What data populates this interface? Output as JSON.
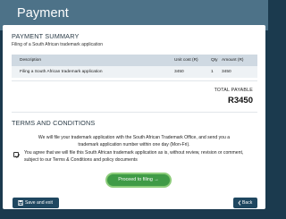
{
  "header": {
    "title": "Payment"
  },
  "summary": {
    "heading": "PAYMENT SUMMARY",
    "subtitle": "Filing of a South African trademark application",
    "table": {
      "headers": [
        "Description",
        "Unit cost (R)",
        "Qty",
        "Amount (R)"
      ],
      "rows": [
        [
          "Filing a South African trademark application",
          "3450",
          "1",
          "3450"
        ]
      ]
    },
    "total_label": "TOTAL PAYABLE",
    "total_value": "R3450"
  },
  "terms": {
    "heading": "TERMS AND CONDITIONS",
    "text": "We will file your trademark application with the South African Trademark Office, and send you a trademark application number within one day (Mon-Fri).",
    "agree_text": "You agree that we will file this South African trademark application as is, without review, revision or comment, subject to our Terms & Conditions and policy documents",
    "agree_checked": true
  },
  "buttons": {
    "proceed": "Proceed to filing →",
    "save_exit": "Save and exit",
    "back": "Back"
  },
  "icons": {
    "checkbox": "check-icon",
    "save": "floppy-disk-icon",
    "back": "chevron-left-icon"
  }
}
